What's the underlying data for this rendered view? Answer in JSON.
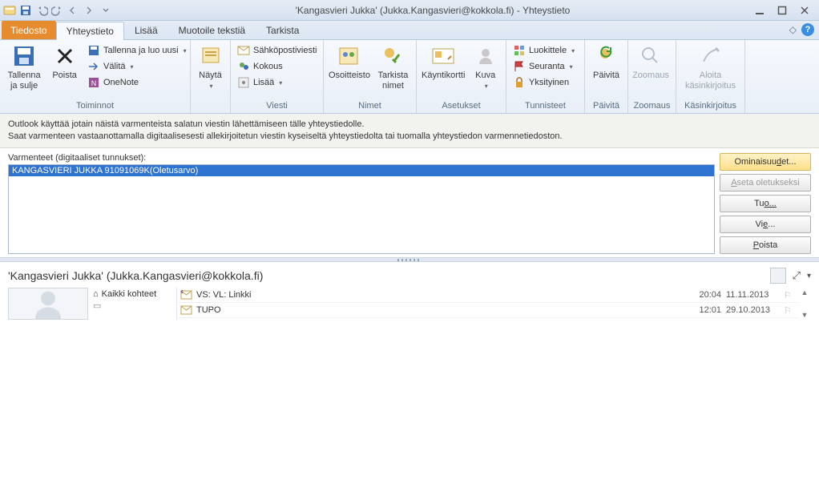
{
  "window": {
    "title": "'Kangasvieri Jukka' (Jukka.Kangasvieri@kokkola.fi)  -  Yhteystieto"
  },
  "tabs": {
    "file": "Tiedosto",
    "items": [
      "Yhteystieto",
      "Lisää",
      "Muotoile tekstiä",
      "Tarkista"
    ],
    "active_index": 0
  },
  "ribbon": {
    "groups": {
      "toiminnot": {
        "label": "Toiminnot",
        "save_close": "Tallenna\nja sulje",
        "delete": "Poista",
        "save_new": "Tallenna ja luo uusi",
        "forward": "Välitä",
        "onenote": "OneNote"
      },
      "nayta": {
        "label": "",
        "show": "Näytä"
      },
      "viesti": {
        "label": "Viesti",
        "email": "Sähköpostiviesti",
        "meeting": "Kokous",
        "more": "Lisää"
      },
      "nimet": {
        "label": "Nimet",
        "addressbook": "Osoitteisto",
        "checknames": "Tarkista\nnimet"
      },
      "asetukset": {
        "label": "Asetukset",
        "bizcard": "Käyntikortti",
        "picture": "Kuva"
      },
      "tunnisteet": {
        "label": "Tunnisteet",
        "categorize": "Luokittele",
        "followup": "Seuranta",
        "private": "Yksityinen"
      },
      "paivita": {
        "label": "Päivitä",
        "update": "Päivitä"
      },
      "zoomaus": {
        "label": "Zoomaus",
        "zoom": "Zoomaus"
      },
      "kasinkirjoitus": {
        "label": "Käsinkirjoitus",
        "ink": "Aloita\nkäsinkirjoitus"
      }
    }
  },
  "info": {
    "line1": "Outlook käyttää jotain näistä varmenteista salatun viestin lähettämiseen tälle yhteystiedolle.",
    "line2": "Saat varmenteen vastaanottamalla digitaalisesesti allekirjoitetun viestin kyseiseltä yhteystiedolta tai tuomalla yhteystiedon varmennetiedoston."
  },
  "certs": {
    "label": "Varmenteet (digitaaliset tunnukset):",
    "rows": [
      "KANGASVIERI JUKKA 91091069K(Oletusarvo)"
    ],
    "buttons": {
      "properties": "Ominaisuudet...",
      "set_default_pre": "A",
      "set_default_rest": "seta oletukseksi",
      "import_pre": "Tu",
      "import_rest": "o...",
      "export_pre": "Vi",
      "export_rest": "e...",
      "remove_pre": "P",
      "remove_rest": "oista"
    }
  },
  "preview": {
    "header": "'Kangasvieri Jukka' (Jukka.Kangasvieri@kokkola.fi)",
    "all_items": "Kaikki kohteet",
    "messages": [
      {
        "subject": "VS: VL: Linkki",
        "time": "20:04",
        "date": "11.11.2013"
      },
      {
        "subject": "TUPO",
        "time": "12:01",
        "date": "29.10.2013"
      }
    ]
  }
}
